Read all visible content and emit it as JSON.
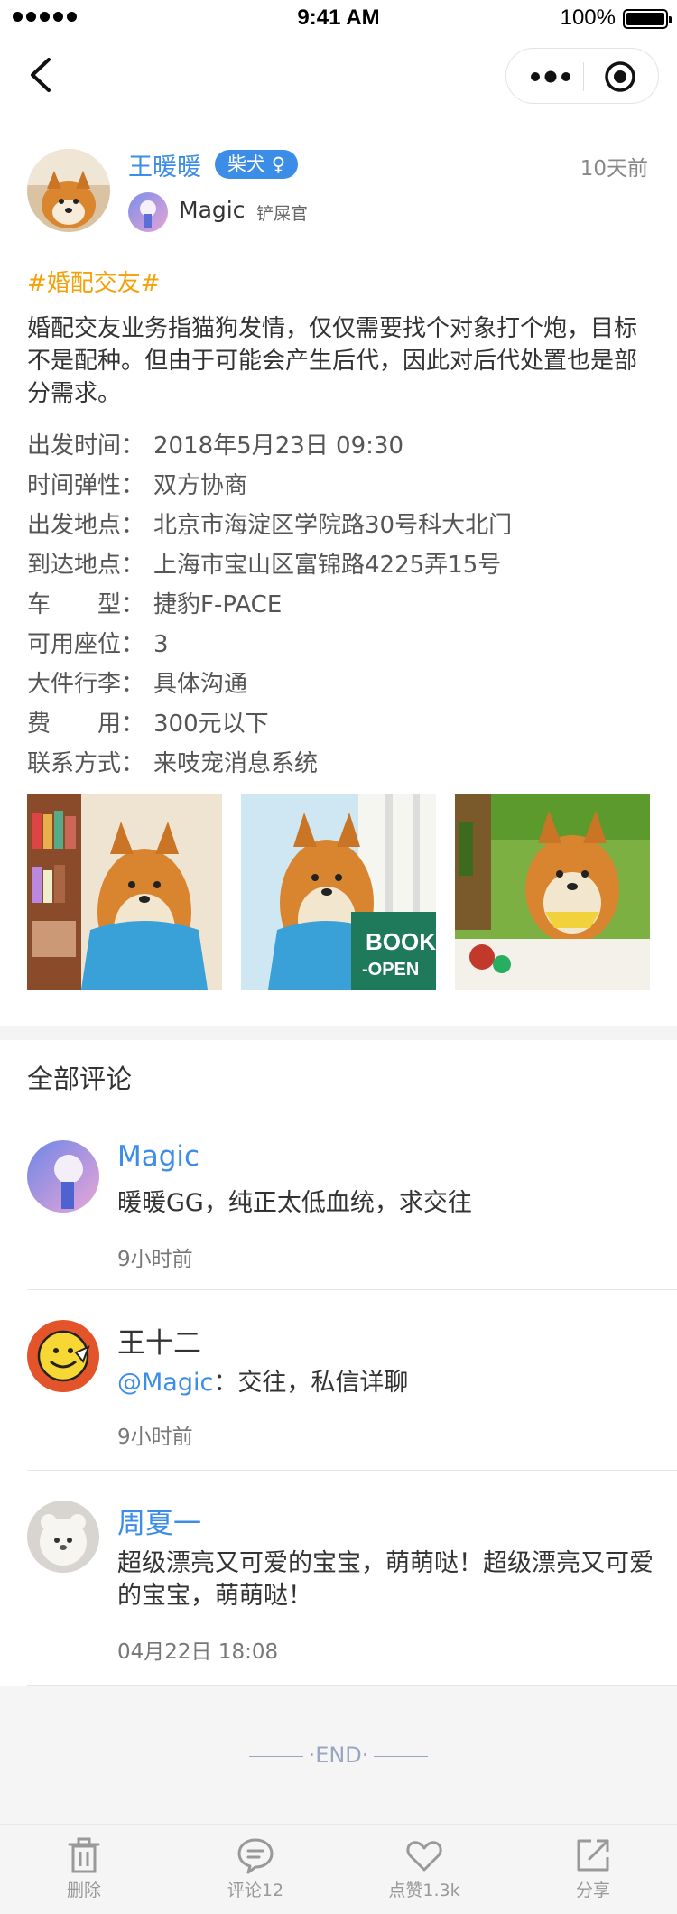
{
  "status_bar": {
    "time": "9:41 AM",
    "battery": "100%",
    "battery_level": 1.0
  },
  "nav": {
    "back_icon": "chevron-left-icon",
    "more_icon": "more-dots-icon",
    "close_icon": "target-icon"
  },
  "post": {
    "author_name": "王暖暖",
    "breed": "柴犬",
    "gender_symbol": "♀",
    "time": "10天前",
    "owner_name": "Magic",
    "owner_role": "铲屎官",
    "hashtag": "#婚配交友#",
    "content": "婚配交友业务指猫狗发情，仅仅需要找个对象打个炮，目标不是配种。但由于可能会产生后代，因此对后代处置也是部分需求。",
    "info": [
      {
        "label": "出发时间：",
        "value": "2018年5月23日 09:30"
      },
      {
        "label": "时间弹性：",
        "value": "双方协商"
      },
      {
        "label": "出发地点：",
        "value": "北京市海淀区学院路30号科大北门"
      },
      {
        "label": "到达地点：",
        "value": "上海市宝山区富锦路4225弄15号"
      },
      {
        "label": "车　　型：",
        "value": "捷豹F-PACE"
      },
      {
        "label": "可用座位：",
        "value": "3"
      },
      {
        "label": "大件行李：",
        "value": "具体沟通"
      },
      {
        "label": "费　　用：",
        "value": "300元以下"
      },
      {
        "label": "联系方式：",
        "value": "来吱宠消息系统"
      }
    ],
    "photo_texts": [
      "BOOK",
      "-OPEN"
    ]
  },
  "comments": {
    "title": "全部评论",
    "items": [
      {
        "name": "Magic",
        "text": "暖暖GG，纯正太低血统，求交往",
        "time": "9小时前"
      },
      {
        "name": "王十二",
        "mention": "@Magic",
        "text": "：交往，私信详聊",
        "time": "9小时前"
      },
      {
        "name": "周夏一",
        "text": "超级漂亮又可爱的宝宝，萌萌哒！超级漂亮又可爱的宝宝，萌萌哒！",
        "time": "04月22日 18:08"
      }
    ]
  },
  "end_text": "END",
  "tabbar": [
    {
      "label": "删除",
      "icon": "trash-icon"
    },
    {
      "label": "评论12",
      "icon": "comment-icon"
    },
    {
      "label": "点赞1.3k",
      "icon": "heart-icon"
    },
    {
      "label": "分享",
      "icon": "share-icon"
    }
  ],
  "colors": {
    "accent_blue": "#3c8de8",
    "hashtag_orange": "#f5a20a",
    "muted_gray": "#999999"
  }
}
